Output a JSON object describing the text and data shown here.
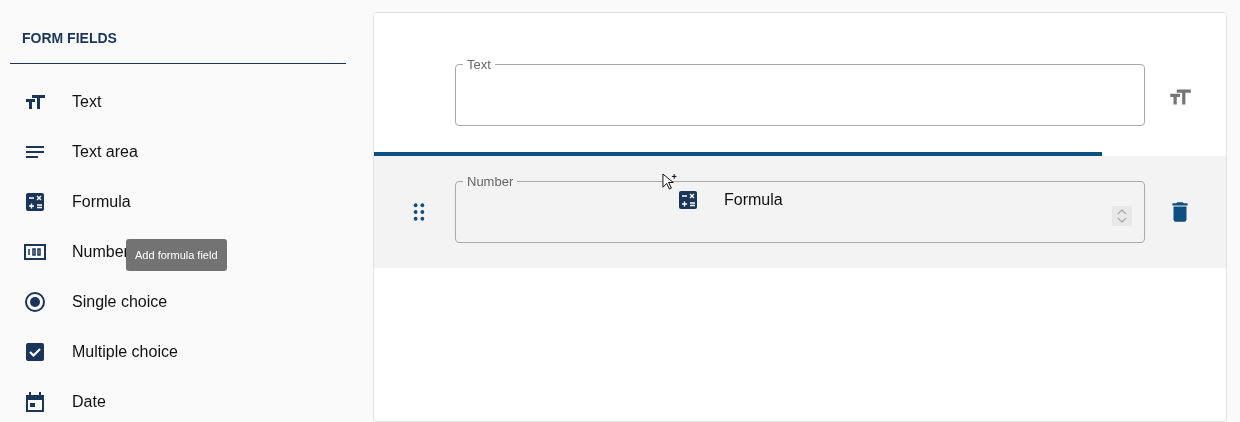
{
  "sidebar": {
    "title": "FORM FIELDS",
    "items": [
      {
        "kind": "text",
        "label": "Text"
      },
      {
        "kind": "textarea",
        "label": "Text area"
      },
      {
        "kind": "formula",
        "label": "Formula"
      },
      {
        "kind": "number",
        "label": "Number"
      },
      {
        "kind": "radio",
        "label": "Single choice"
      },
      {
        "kind": "checkbox",
        "label": "Multiple choice"
      },
      {
        "kind": "date",
        "label": "Date"
      }
    ]
  },
  "tooltip": "Add formula field",
  "canvas": {
    "fields": [
      {
        "kind": "text",
        "label": "Text",
        "selected": false
      },
      {
        "kind": "number",
        "label": "Number",
        "selected": true
      }
    ]
  },
  "drag_preview": {
    "kind": "formula",
    "label": "Formula"
  }
}
